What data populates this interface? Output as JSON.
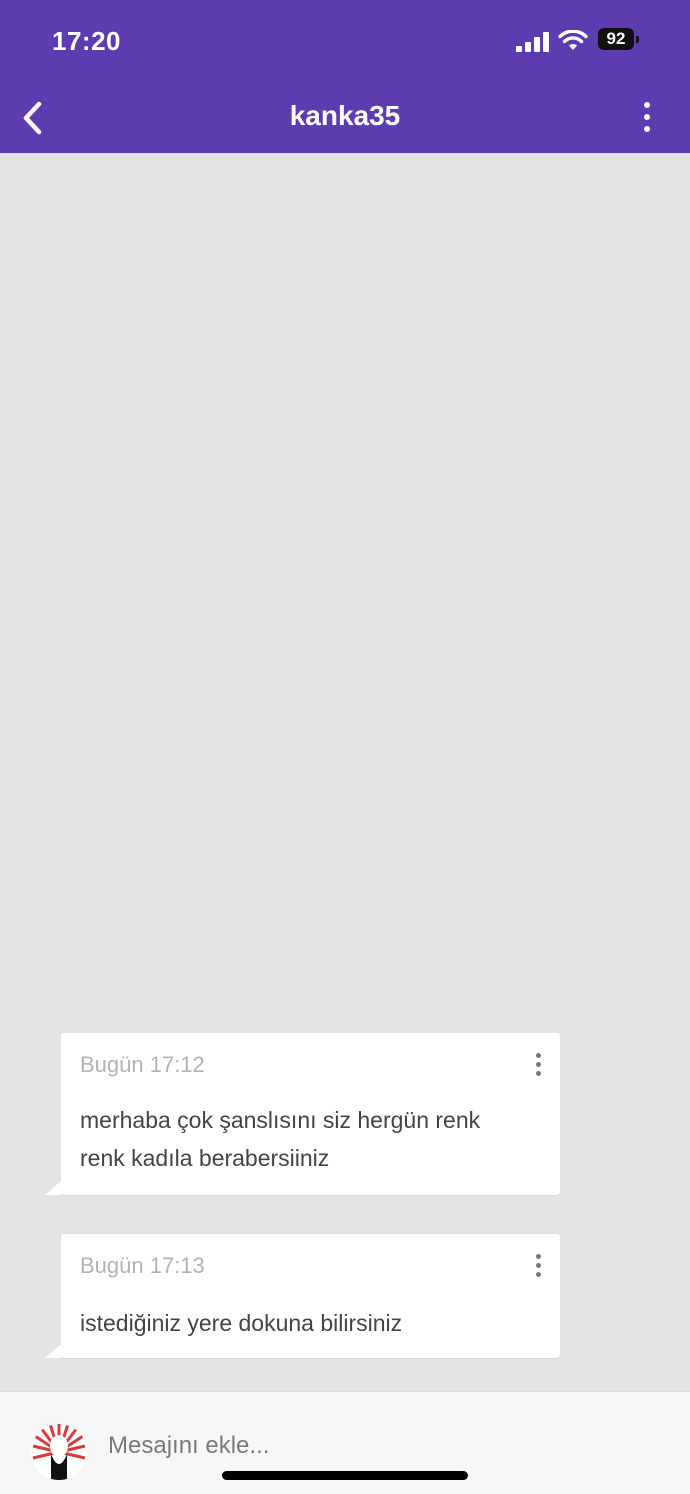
{
  "status_bar": {
    "time": "17:20",
    "battery": "92",
    "icons": [
      "signal-icon",
      "wifi-icon",
      "battery-icon"
    ]
  },
  "header": {
    "title": "kanka35",
    "back_icon": "chevron-left-icon",
    "menu_icon": "more-vertical-icon"
  },
  "messages": [
    {
      "time": "Bugün 17:12",
      "text_line1": "merhaba çok şanslısını siz hergün renk",
      "text_line2": "renk kadıla berabersiiniz"
    },
    {
      "time": "Bugün 17:13",
      "text_line1": "istediğiniz yere dokuna bilirsiniz"
    }
  ],
  "composer": {
    "placeholder": "Mesajını ekle..."
  },
  "colors": {
    "header_bg": "#5f3bb0",
    "chat_bg": "#e3e3e3",
    "bubble_bg": "#ffffff"
  }
}
